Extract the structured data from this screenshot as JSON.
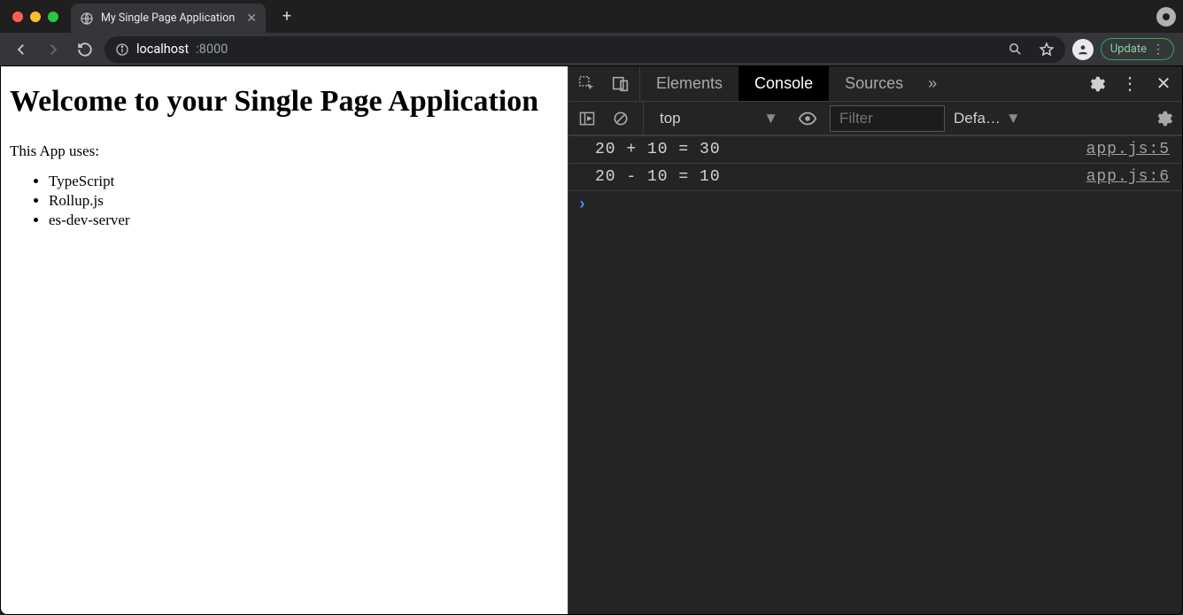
{
  "browser": {
    "tab_title": "My Single Page Application",
    "address_host": "localhost",
    "address_port": ":8000",
    "update_label": "Update"
  },
  "page": {
    "heading": "Welcome to your Single Page Application",
    "intro": "This App uses:",
    "items": [
      "TypeScript",
      "Rollup.js",
      "es-dev-server"
    ]
  },
  "devtools": {
    "tabs": {
      "elements": "Elements",
      "console": "Console",
      "sources": "Sources"
    },
    "overflow_glyph": "»",
    "context_label": "top",
    "filter_placeholder": "Filter",
    "levels_label": "Defa…",
    "logs": [
      {
        "message": "20 + 10 = 30",
        "source": "app.js:5"
      },
      {
        "message": "20 - 10 = 10",
        "source": "app.js:6"
      }
    ]
  }
}
